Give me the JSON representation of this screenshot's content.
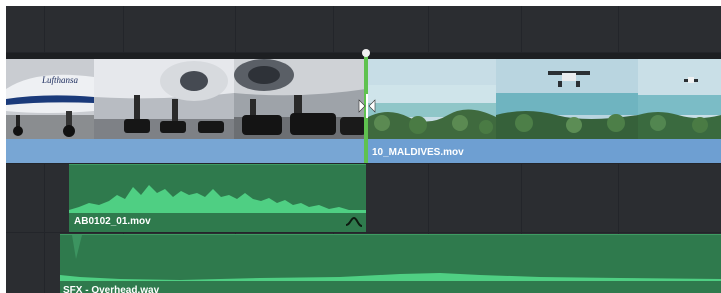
{
  "video_track": {
    "clip_left": {
      "name": "",
      "thumbnails": [
        "airplane-nose-thumbnail",
        "airplane-gear-thumbnail",
        "airplane-wheels-thumbnail",
        "airplane-wheels-closeup-thumbnail"
      ]
    },
    "clip_right": {
      "name": "10_MALDIVES.mov",
      "thumbnails": [
        "seaplane-water-thumbnail",
        "seaplane-takeoff-thumbnail",
        "coral-reef-thumbnail",
        "seaplane-distance-thumbnail"
      ]
    }
  },
  "audio_tracks": [
    {
      "name": "AB0102_01.mov",
      "icon": "fade-curve-icon"
    },
    {
      "name": "SFX - Overhead.wav"
    }
  ],
  "colors": {
    "timeline_bg": "#2b2d31",
    "video_clip_bar": "#78a6d4",
    "audio_clip": "#2f7a4d",
    "waveform": "#4fcf83",
    "edit_point": "#5fc24f"
  },
  "edit_point": {
    "cursor": "trim-cursor-icon"
  }
}
